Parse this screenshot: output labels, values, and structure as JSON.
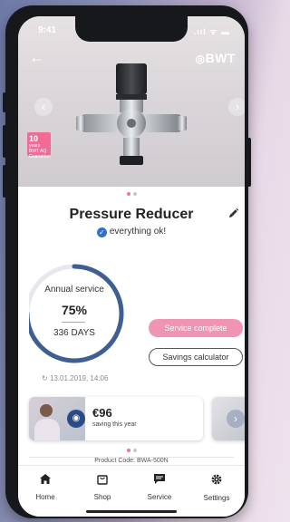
{
  "status_bar": {
    "time": "9:41",
    "icons": ".ııl ᯤ ▬"
  },
  "header": {
    "brand": "BWT"
  },
  "hero": {
    "badge_big": "10",
    "badge_small": "years BWT AQ Guarantee"
  },
  "product": {
    "title": "Pressure Reducer",
    "status": "everything ok!"
  },
  "annual_service": {
    "label": "Annual service",
    "percent": "75%",
    "days": "336 DAYS",
    "progress": 0.75
  },
  "buttons": {
    "service_complete": "Service complete",
    "savings_calculator": "Savings calculator"
  },
  "last_update": "13.01.2019, 14:06",
  "savings_card": {
    "amount": "€96",
    "subtitle": "saving this year"
  },
  "product_code_peek": "Product Code: BWA-500N",
  "tabs": [
    {
      "label": "Home",
      "icon": "home-icon"
    },
    {
      "label": "Shop",
      "icon": "shop-bag-icon"
    },
    {
      "label": "Service",
      "icon": "chat-icon"
    },
    {
      "label": "Settings",
      "icon": "gear-icon"
    }
  ],
  "colors": {
    "accent_pink": "#ef94b2",
    "ring_blue": "#3f5f94",
    "check_blue": "#2f6fd1"
  }
}
